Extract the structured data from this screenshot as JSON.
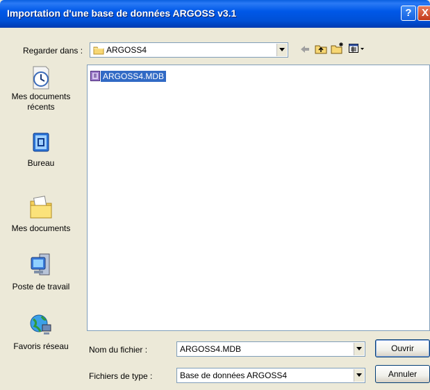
{
  "window": {
    "title": "Importation d'une base de données ARGOSS v3.1",
    "help_glyph": "?",
    "close_glyph": "X"
  },
  "lookin": {
    "label": "Regarder dans :",
    "value": "ARGOSS4"
  },
  "toolbar": {
    "icons": [
      "back-arrow-icon",
      "up-folder-icon",
      "new-folder-icon",
      "view-menu-icon"
    ]
  },
  "places": [
    {
      "label": "Mes documents récents",
      "icon": "recent-documents-icon"
    },
    {
      "label": "Bureau",
      "icon": "desktop-icon"
    },
    {
      "label": "Mes documents",
      "icon": "my-documents-icon"
    },
    {
      "label": "Poste de travail",
      "icon": "my-computer-icon"
    },
    {
      "label": "Favoris réseau",
      "icon": "network-places-icon"
    }
  ],
  "files": [
    {
      "name": "ARGOSS4.MDB",
      "selected": true
    }
  ],
  "filename": {
    "label": "Nom du fichier :",
    "value": "ARGOSS4.MDB"
  },
  "filetype": {
    "label": "Fichiers de type :",
    "value": "Base de données ARGOSS4"
  },
  "buttons": {
    "open": "Ouvrir",
    "cancel": "Annuler"
  }
}
